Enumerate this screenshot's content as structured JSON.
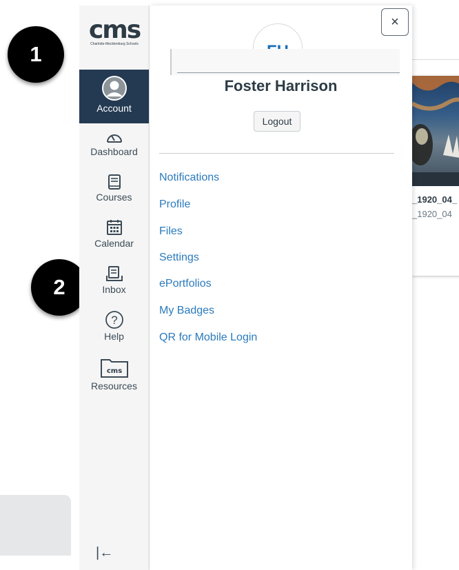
{
  "callouts": {
    "one": "1",
    "two": "2"
  },
  "nav": {
    "logo_text": "cms",
    "logo_subtext": "Charlotte-Mecklenburg Schools",
    "items": [
      {
        "label": "Account",
        "icon": "account-avatar-icon"
      },
      {
        "label": "Dashboard",
        "icon": "speedometer-icon"
      },
      {
        "label": "Courses",
        "icon": "book-icon"
      },
      {
        "label": "Calendar",
        "icon": "calendar-icon"
      },
      {
        "label": "Inbox",
        "icon": "inbox-icon"
      },
      {
        "label": "Help",
        "icon": "question-circle-icon"
      },
      {
        "label": "Resources",
        "icon": "cms-folder-icon"
      }
    ],
    "resources_icon_text": "cms",
    "collapse_glyph": "|←"
  },
  "tray": {
    "close_glyph": "×",
    "avatar_initials": "FH",
    "user_name": "Foster Harrison",
    "logout_label": "Logout",
    "links": [
      "Notifications",
      "Profile",
      "Files",
      "Settings",
      "ePortfolios",
      "My Badges",
      "QR for Mobile Login"
    ]
  },
  "background_card": {
    "title": "_1920_04_",
    "subtitle": "_1920_04"
  },
  "colors": {
    "nav_active_bg": "#233a52",
    "link": "#2b7abc",
    "nav_bg": "#f5f5f5",
    "text": "#2d3b45"
  }
}
